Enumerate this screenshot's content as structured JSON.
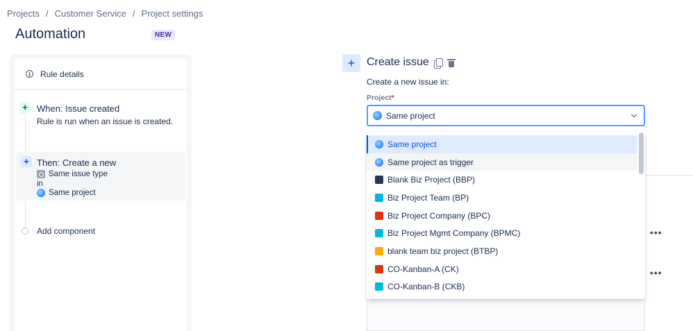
{
  "breadcrumb": [
    "Projects",
    "Customer Service",
    "Project settings"
  ],
  "page_title": "Automation",
  "badge": "NEW",
  "rule": {
    "details_label": "Rule details",
    "trigger": {
      "title": "When: Issue created",
      "description": "Rule is run when an issue is created."
    },
    "action": {
      "title": "Then: Create a new",
      "line1": "Same issue type",
      "line2": "in",
      "line3": "Same project"
    },
    "add_component": "Add component"
  },
  "config": {
    "title": "Create issue",
    "subtitle": "Create a new issue in:",
    "project_label": "Project",
    "required_mark": "*",
    "selected_value": "Same project"
  },
  "dropdown": {
    "options": [
      {
        "label": "Same project",
        "icon": "globe-icon",
        "color": "#2684ff",
        "state": "selected"
      },
      {
        "label": "Same project as trigger",
        "icon": "globe-icon",
        "color": "#2684ff",
        "state": "hover"
      },
      {
        "label": "Blank Biz Project (BBP)",
        "icon": "rocket-avatar-icon",
        "color": "#253858",
        "state": ""
      },
      {
        "label": "Biz Project Team (BP)",
        "icon": "notepad-avatar-icon",
        "color": "#00b8d9",
        "state": ""
      },
      {
        "label": "Biz Project Company (BPC)",
        "icon": "satellite-avatar-icon",
        "color": "#de350b",
        "state": ""
      },
      {
        "label": "Biz Project Mgmt Company (BPMC)",
        "icon": "plane-avatar-icon",
        "color": "#00b8d9",
        "state": ""
      },
      {
        "label": "blank team biz project (BTBP)",
        "icon": "book-avatar-icon",
        "color": "#ffab00",
        "state": ""
      },
      {
        "label": "CO-Kanban-A (CK)",
        "icon": "board-avatar-icon",
        "color": "#de350b",
        "state": ""
      },
      {
        "label": "CO-Kanban-B (CKB)",
        "icon": "board-avatar-icon",
        "color": "#00b8d9",
        "state": ""
      }
    ]
  },
  "colors": {
    "accent": "#0052cc",
    "selected_bg": "#deebff",
    "focus_border": "#4c9aff"
  }
}
